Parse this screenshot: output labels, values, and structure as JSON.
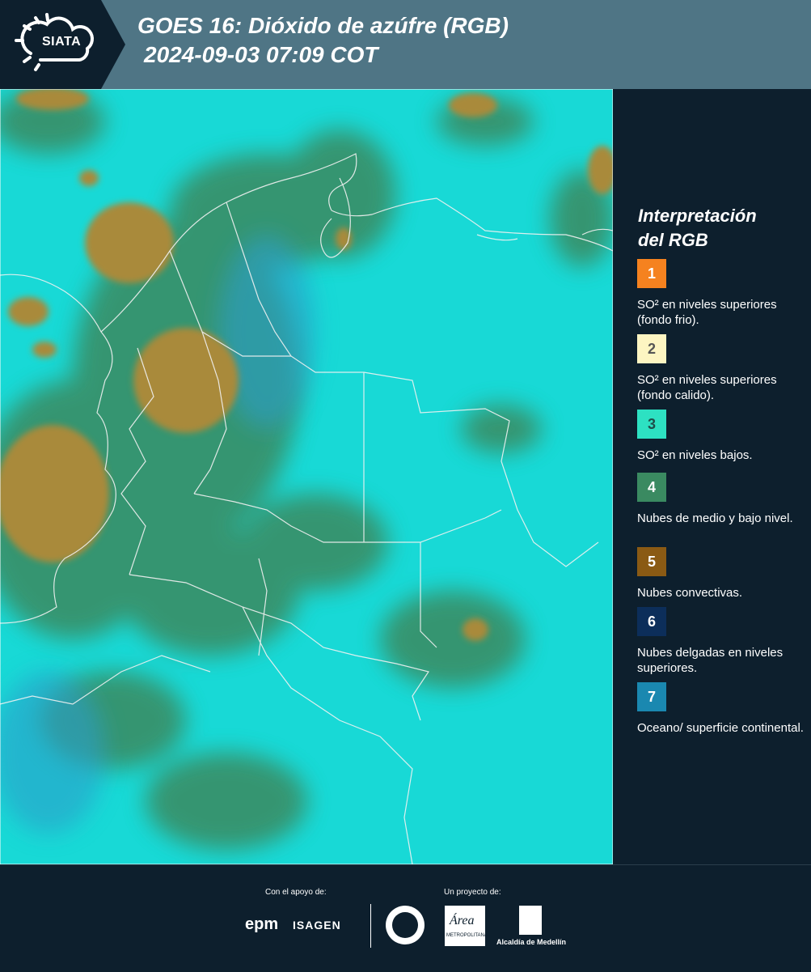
{
  "header": {
    "logo_text": "SIATA",
    "title_line1": "GOES 16: Dióxido de azúfre (RGB)",
    "title_line2": "2024-09-03 07:09 COT"
  },
  "legend": {
    "title_line1": "Interpretación",
    "title_line2": "del RGB",
    "items": [
      {
        "number": "1",
        "label": "SO² en niveles superiores (fondo frio).",
        "color": "#f5821f",
        "text_color": "#ffffff"
      },
      {
        "number": "2",
        "label": "SO² en niveles superiores (fondo calido).",
        "color": "#fdf5c2",
        "text_color": "#555555"
      },
      {
        "number": "3",
        "label": "SO² en niveles bajos.",
        "color": "#2de1c2",
        "text_color": "#1f4e4a"
      },
      {
        "number": "4",
        "label": "Nubes de medio y bajo nivel.",
        "color": "#3a8a61",
        "text_color": "#ffffff"
      },
      {
        "number": "5",
        "label": "Nubes convectivas.",
        "color": "#8a5a14",
        "text_color": "#ffffff"
      },
      {
        "number": "6",
        "label": "Nubes delgadas en niveles superiores.",
        "color": "#0c2e5a",
        "text_color": "#ffffff"
      },
      {
        "number": "7",
        "label": "Oceano/ superficie continental.",
        "color": "#1a88b0",
        "text_color": "#ffffff"
      }
    ]
  },
  "footer": {
    "support_label": "Con el apoyo de:",
    "project_label": "Un proyecto de:",
    "epm": "epm",
    "isagen": "ISAGEN",
    "area_text": "Área",
    "area_sub": "METROPOLITANA",
    "alcaldia": "Alcaldía de Medellín"
  },
  "map": {
    "colors": {
      "sky": "#16dbd8",
      "green": "#3a8a61",
      "brown": "#9a7a2a",
      "dark": "#0e3a4a"
    }
  }
}
